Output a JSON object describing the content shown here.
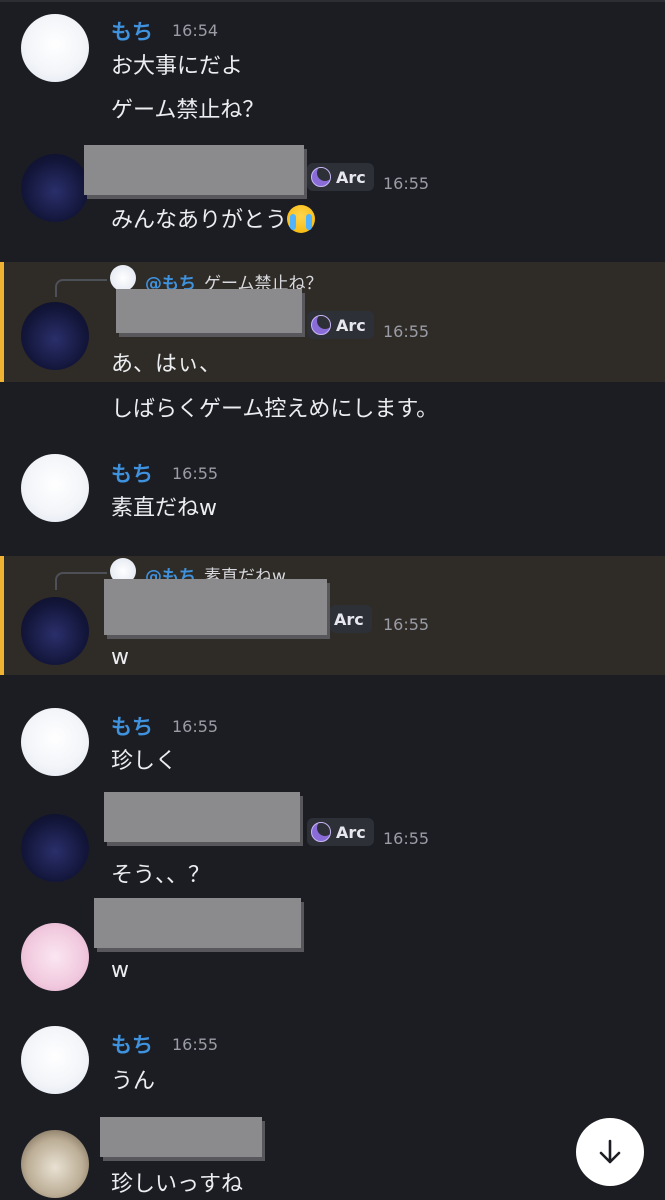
{
  "messages": {
    "m1": {
      "author": "もち",
      "time": "16:54",
      "lines": [
        "お大事にだよ",
        "ゲーム禁止ね？"
      ]
    },
    "m2": {
      "badge": "Arc",
      "time": "16:55",
      "text": "みんなありがとう"
    },
    "m3": {
      "reply_name": "@もち",
      "reply_text": "ゲーム禁止ね？",
      "badge": "Arc",
      "time": "16:55",
      "lines": [
        "あ、はぃ、",
        "しばらくゲーム控えめにします。"
      ]
    },
    "m4": {
      "author": "もち",
      "time": "16:55",
      "text": "素直だねw"
    },
    "m5": {
      "reply_name": "@もち",
      "reply_text": "素直だねw",
      "badge": "Arc",
      "time": "16:55",
      "text": "w"
    },
    "m6": {
      "author": "もち",
      "time": "16:55",
      "text": "珍しく"
    },
    "m7": {
      "badge": "Arc",
      "time": "16:55",
      "text": "そう、、？"
    },
    "m8": {
      "text": "w"
    },
    "m9": {
      "author": "もち",
      "time": "16:55",
      "text": "うん"
    },
    "m10": {
      "text": "珍しいっすね"
    }
  },
  "icons": {
    "scroll_down": "arrow-down-icon",
    "emoji": "loudly-crying-face",
    "badge_icon": "crescent-moon-icon"
  },
  "colors": {
    "background": "#1c1d22",
    "username": "#3f92de",
    "highlight": "#2f2b27",
    "highlight_bar": "#f0b232"
  }
}
